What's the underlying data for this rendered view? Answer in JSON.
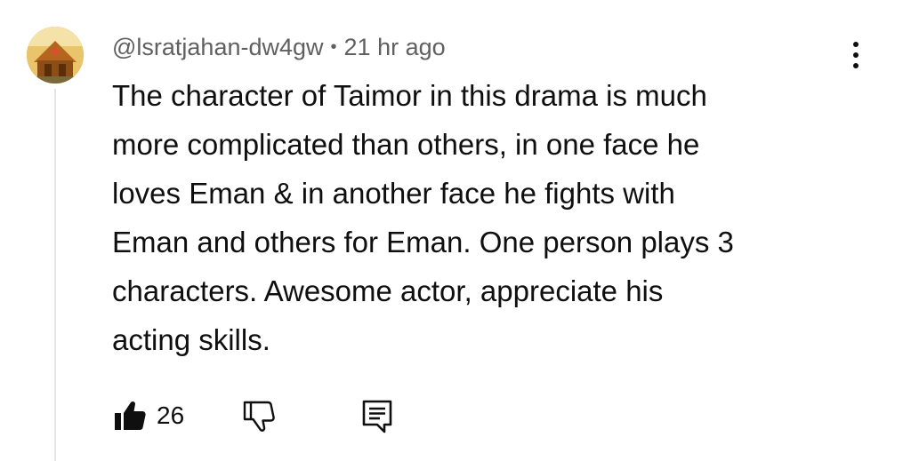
{
  "comment": {
    "author": "@lsratjahan-dw4gw",
    "separator": "•",
    "time": "21 hr ago",
    "text": "The character of Taimor in this drama is much\nmore complicated than others, in one face he\nloves Eman & in another face he fights with\nEman and others for Eman. One person plays 3\ncharacters. Awesome actor, appreciate his\nacting skills.",
    "like_count": "26"
  },
  "icons": {
    "avatar": "profile-picture",
    "more": "vertical-ellipsis-icon",
    "like": "thumbs-up-filled-icon",
    "dislike": "thumbs-down-outline-icon",
    "reply": "comment-reply-icon"
  },
  "colors": {
    "text": "#0f0f0f",
    "meta_text": "#606060",
    "thread_line": "#e5e5e5",
    "background": "#ffffff"
  }
}
